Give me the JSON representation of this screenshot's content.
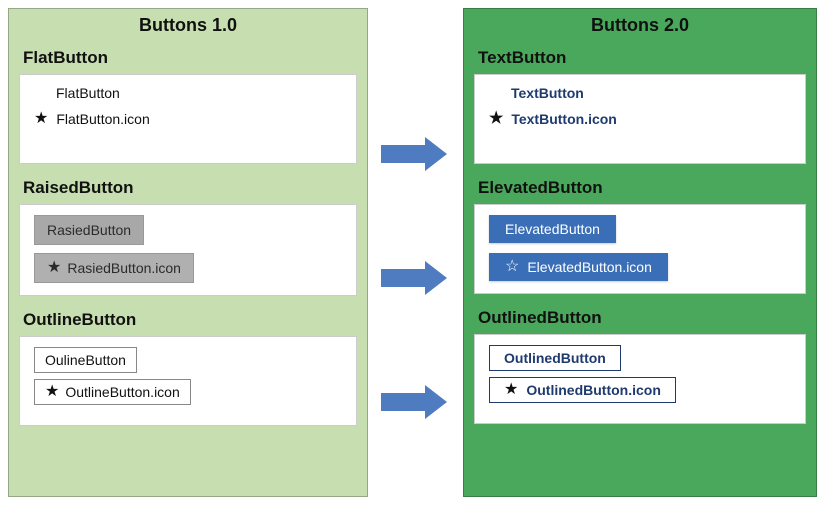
{
  "left": {
    "title": "Buttons 1.0",
    "sections": {
      "flat": {
        "title": "FlatButton",
        "plain": "FlatButton",
        "icon": "FlatButton.icon"
      },
      "raised": {
        "title": "RaisedButton",
        "plain": "RasiedButton",
        "icon": "RasiedButton.icon"
      },
      "outline": {
        "title": "OutlineButton",
        "plain": "OulineButton",
        "icon": "OutlineButton.icon"
      }
    }
  },
  "right": {
    "title": "Buttons 2.0",
    "sections": {
      "text": {
        "title": "TextButton",
        "plain": "TextButton",
        "icon": "TextButton.icon"
      },
      "elevated": {
        "title": "ElevatedButton",
        "plain": "ElevatedButton",
        "icon": "ElevatedButton.icon"
      },
      "outlined": {
        "title": "OutlinedButton",
        "plain": "OutlinedButton",
        "icon": "OutlinedButton.icon"
      }
    }
  },
  "glyphs": {
    "star": "★",
    "star_outline": "☆"
  }
}
